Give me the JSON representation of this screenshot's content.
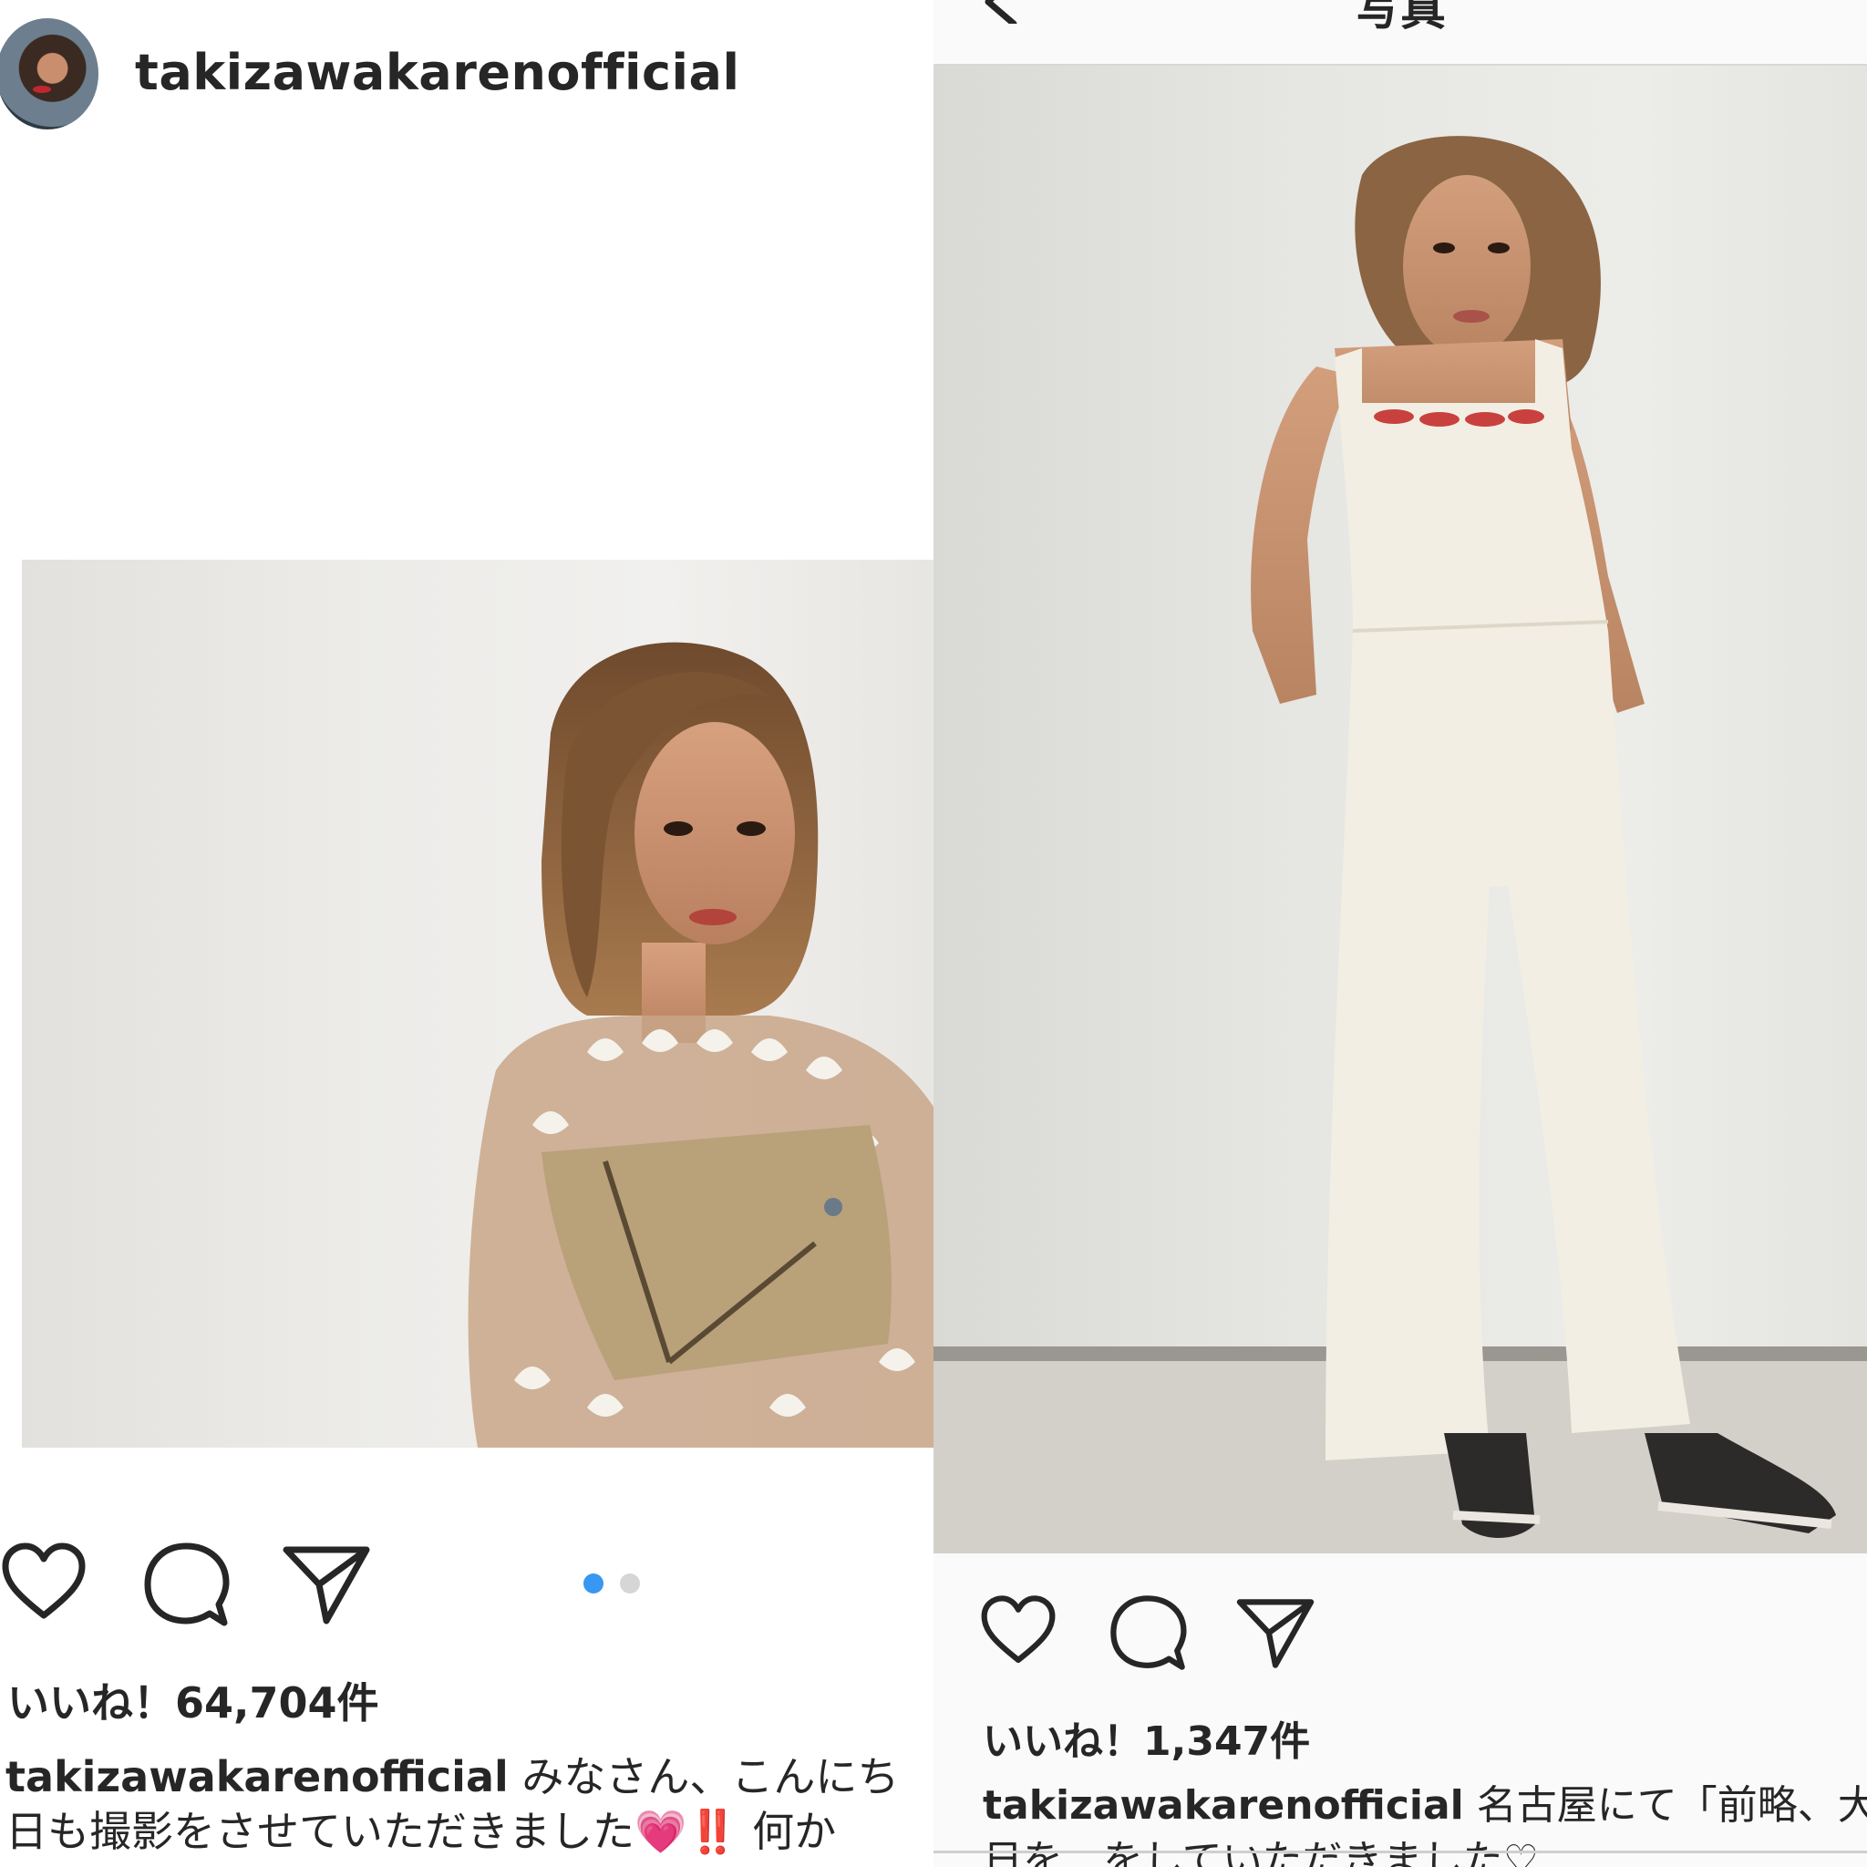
{
  "left_post": {
    "username": "takizawakarenofficial",
    "likes": "いいね！64,704件",
    "caption_user": "takizawakarenofficial",
    "caption_line1": " みなさん、こんにち",
    "caption_line2": "日も撮影をさせていただきました💗‼️ 何か",
    "carousel": {
      "total": 2,
      "active": 1
    },
    "icons": [
      "heart-icon",
      "comment-icon",
      "share-icon"
    ]
  },
  "right_post": {
    "title": "写真",
    "likes": "いいね！1,347件",
    "caption_user": "takizawakarenofficial",
    "caption_line1": " 名古屋にて「前略、大",
    "caption_line2": "日を…をしていただきました♡",
    "icons": [
      "back-arrow-icon",
      "heart-icon",
      "comment-icon",
      "share-icon"
    ]
  },
  "colors": {
    "active_dot": "#3897f0",
    "inactive_dot": "#d6d6d6",
    "text": "#262626"
  }
}
